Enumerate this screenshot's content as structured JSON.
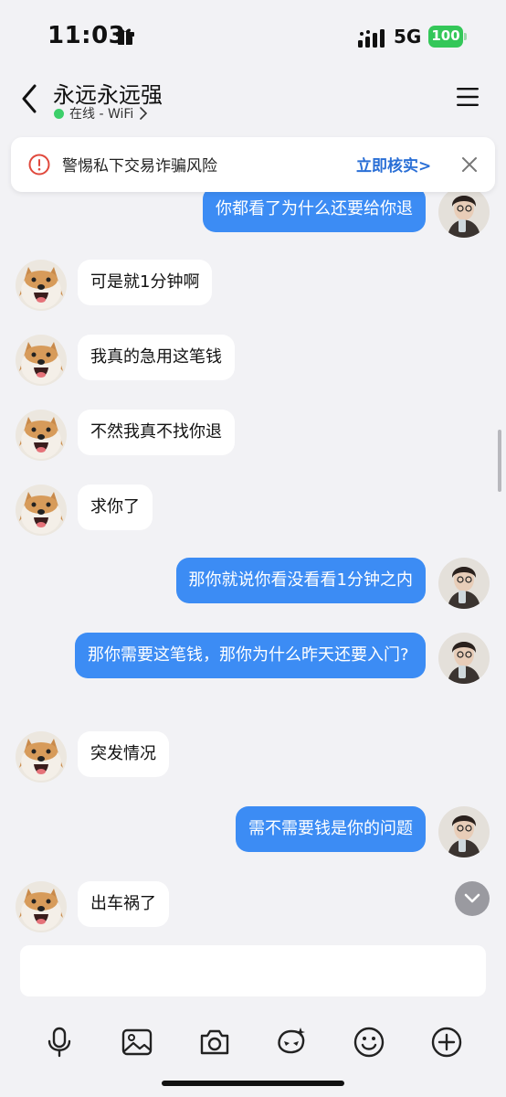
{
  "status_bar": {
    "time": "11:03",
    "network": "5G",
    "battery": "100",
    "icons": [
      "gift-icon",
      "signal-icon"
    ]
  },
  "header": {
    "contact_name": "永远永远强",
    "status": "在线 - WiFi",
    "icons": [
      "back-chevron-icon",
      "chevron-right-icon",
      "menu-icon"
    ]
  },
  "warning": {
    "text": "警惕私下交易诈骗风险",
    "action": "立即核实>",
    "icons": [
      "warning-circle-icon",
      "close-icon"
    ]
  },
  "messages": [
    {
      "side": "out",
      "text": "你都看了为什么还要给你退"
    },
    {
      "side": "in",
      "text": "可是就1分钟啊"
    },
    {
      "side": "in",
      "text": "我真的急用这笔钱"
    },
    {
      "side": "in",
      "text": "不然我真不找你退"
    },
    {
      "side": "in",
      "text": "求你了"
    },
    {
      "side": "out",
      "text": "那你就说你看没看看1分钟之内"
    },
    {
      "side": "out",
      "text": "那你需要这笔钱，那你为什么昨天还要入门?"
    },
    {
      "side": "in",
      "text": "突发情况"
    },
    {
      "side": "out",
      "text": "需不需要钱是你的问题"
    },
    {
      "side": "in",
      "text": "出车祸了"
    }
  ],
  "input": {
    "value": "",
    "placeholder": ""
  },
  "toolbar": {
    "icons": [
      "microphone-icon",
      "image-icon",
      "camera-icon",
      "sticker-icon",
      "emoji-icon",
      "plus-icon"
    ]
  },
  "colors": {
    "outgoing_bubble": "#3c8cf4",
    "incoming_bubble": "#ffffff",
    "background": "#f2f2f5",
    "online": "#3ccf6a",
    "battery": "#34c759",
    "warning": "#e0483c",
    "link": "#2a6fd6"
  }
}
